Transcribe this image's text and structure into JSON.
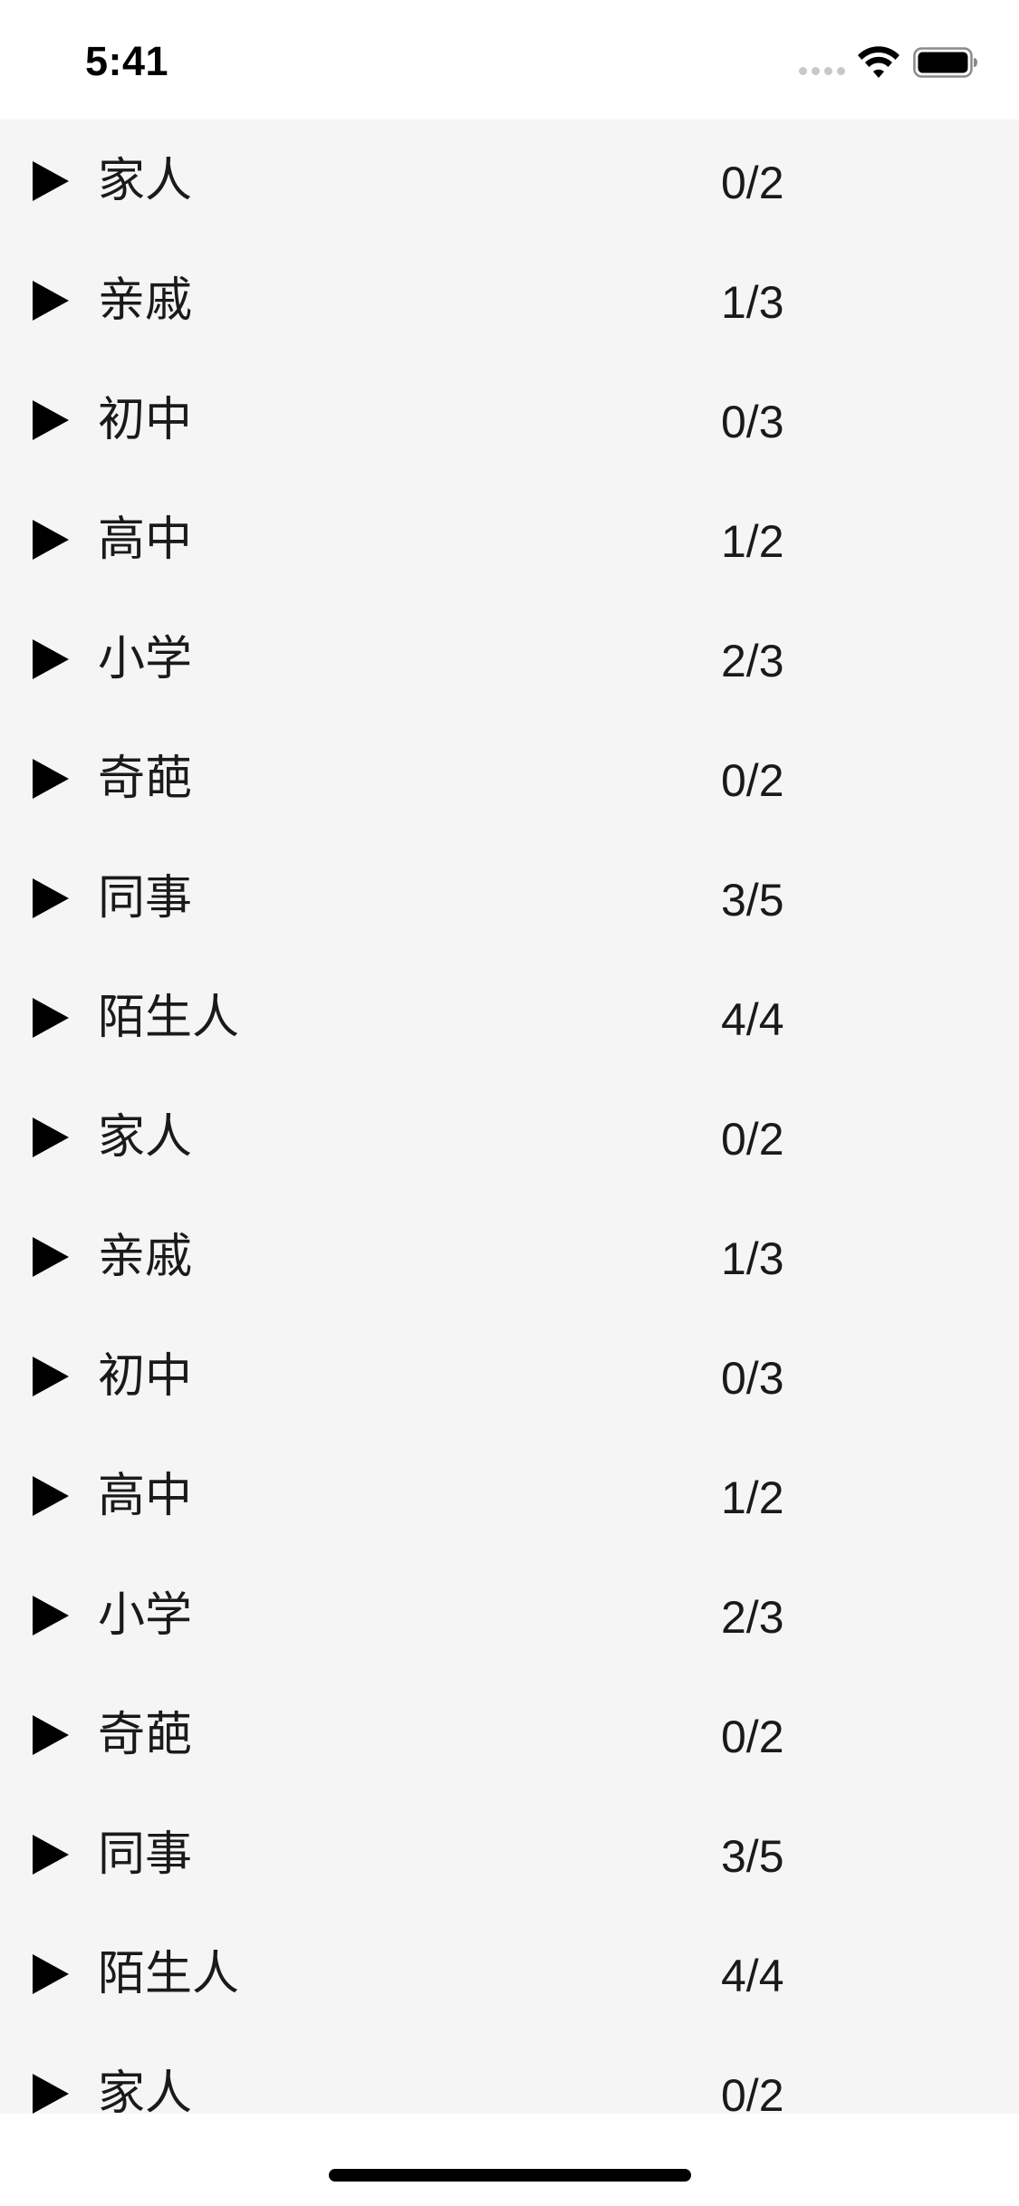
{
  "status_bar": {
    "time": "5:41"
  },
  "icons": {
    "arrow": "play-triangle-icon",
    "wifi": "wifi-icon",
    "battery": "battery-icon"
  },
  "groups": [
    {
      "name": "家人",
      "count": "0/2"
    },
    {
      "name": "亲戚",
      "count": "1/3"
    },
    {
      "name": "初中",
      "count": "0/3"
    },
    {
      "name": "高中",
      "count": "1/2"
    },
    {
      "name": "小学",
      "count": "2/3"
    },
    {
      "name": "奇葩",
      "count": "0/2"
    },
    {
      "name": "同事",
      "count": "3/5"
    },
    {
      "name": "陌生人",
      "count": "4/4"
    },
    {
      "name": "家人",
      "count": "0/2"
    },
    {
      "name": "亲戚",
      "count": "1/3"
    },
    {
      "name": "初中",
      "count": "0/3"
    },
    {
      "name": "高中",
      "count": "1/2"
    },
    {
      "name": "小学",
      "count": "2/3"
    },
    {
      "name": "奇葩",
      "count": "0/2"
    },
    {
      "name": "同事",
      "count": "3/5"
    },
    {
      "name": "陌生人",
      "count": "4/4"
    },
    {
      "name": "家人",
      "count": "0/2"
    }
  ]
}
